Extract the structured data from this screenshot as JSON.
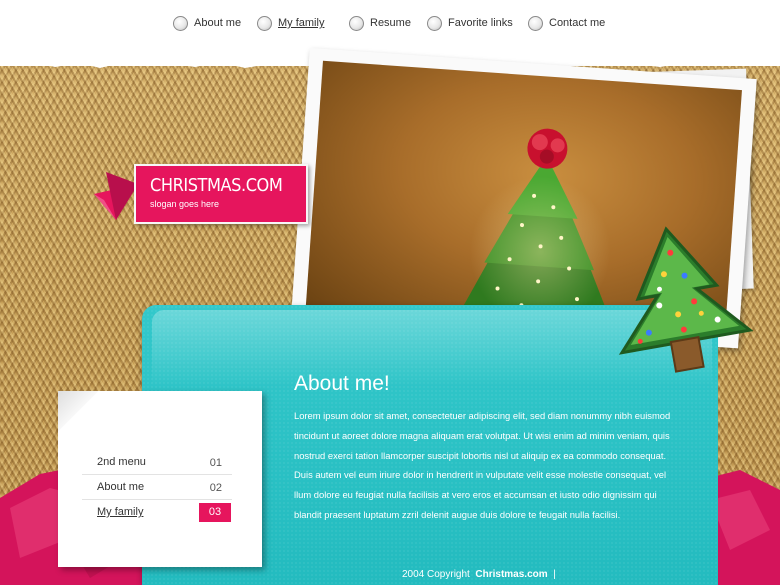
{
  "nav": {
    "items": [
      {
        "label": "About me",
        "active": false
      },
      {
        "label": "My family",
        "active": true
      },
      {
        "label": "Resume",
        "active": false
      },
      {
        "label": "Favorite links",
        "active": false
      },
      {
        "label": "Contact me",
        "active": false
      }
    ]
  },
  "logo": {
    "title": "CHRISTMAS.COM",
    "slogan": "slogan goes here"
  },
  "content": {
    "heading": "About me!",
    "body": "Lorem ipsum dolor sit amet, consectetuer adipiscing elit, sed diam nonummy nibh euismod tincidunt ut aoreet dolore magna aliquam erat volutpat. Ut wisi enim ad minim veniam, quis nostrud exerci tation llamcorper suscipit lobortis nisl ut aliquip ex ea commodo consequat. Duis autem vel eum iriure dolor in hendrerit in vulputate velit esse molestie consequat, vel llum dolore eu feugiat nulla facilisis at vero eros et accumsan et iusto odio dignissim qui blandit praesent luptatum zzril delenit augue duis dolore te feugait nulla facilisi."
  },
  "menu": {
    "items": [
      {
        "label": "2nd menu",
        "number": "01",
        "active": false
      },
      {
        "label": "About me",
        "number": "02",
        "active": false
      },
      {
        "label": "My family",
        "number": "03",
        "active": true
      }
    ]
  },
  "footer": {
    "copyright": "2004 Copyright",
    "site": "Christmas.com",
    "separator": "|"
  },
  "colors": {
    "accent_pink": "#e6155d",
    "panel_teal": "#27bfc3",
    "burlap": "#c9a45c"
  },
  "icons": [
    "radio-button-icon",
    "ribbon-icon",
    "christmas-tree-photo",
    "cookie-tree-icon"
  ]
}
